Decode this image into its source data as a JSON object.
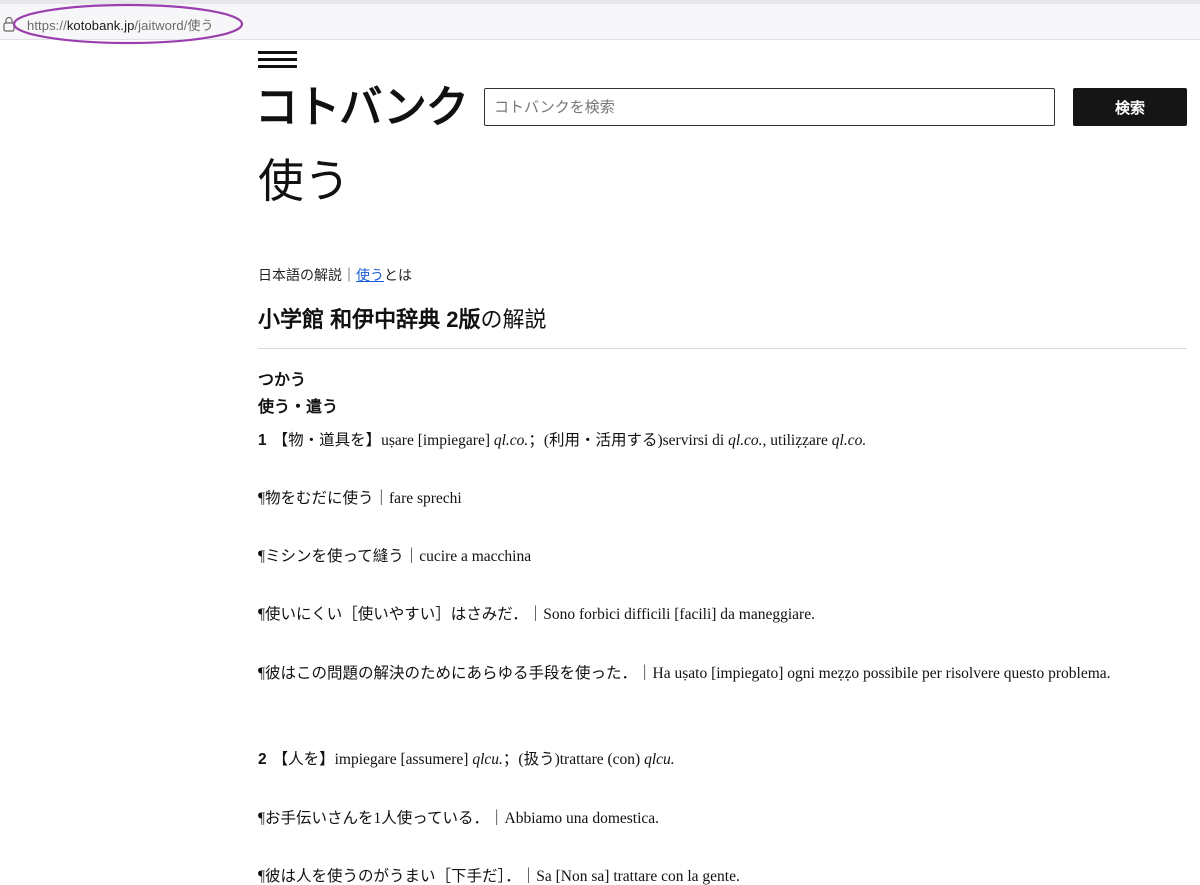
{
  "browser": {
    "url_prefix": "https://",
    "url_host": "kotobank.jp",
    "url_path": "/jaitword/使う"
  },
  "header": {
    "logo": "コトバンク",
    "search_placeholder": "コトバンクを検索",
    "search_button": "検索"
  },
  "page_title": "使う",
  "breadcrumb": {
    "prefix": "日本語の解説｜",
    "link": "使う",
    "suffix": "とは"
  },
  "dictionary": {
    "name": "小学館 和伊中辞典 2版",
    "suffix": "の解説"
  },
  "entry": {
    "reading": "つかう",
    "headword": "使う・遣う",
    "sense1": {
      "num": "1",
      "a": "【物・道具を】uṣare [impiegare] ",
      "b": "ql.co.",
      "c": "；(利用・活用する)servirsi di ",
      "d": "ql.co.",
      "e": ", utiliẓẓare ",
      "f": "ql.co."
    },
    "ex1": "¶物をむだに使う｜fare sprechi",
    "ex2": "¶ミシンを使って縫う｜cucire a macchina",
    "ex3": "¶使いにくい［使いやすい］はさみだ．｜Sono forbici difficili [facili] da maneggiare.",
    "ex4": "¶彼はこの問題の解決のためにあらゆる手段を使った．｜Ha uṣato [impiegato] ogni meẓẓo possibile per risolvere questo problema.",
    "sense2": {
      "num": "2",
      "a": "【人を】impiegare [assumere] ",
      "b": "qlcu.",
      "c": "；(扱う)trattare (con) ",
      "d": "qlcu."
    },
    "ex5": "¶お手伝いさんを1人使っている．｜Abbiamo una domestica.",
    "ex6": "¶彼は人を使うのがうまい［下手だ］．｜Sa [Non sa] trattare con la gente."
  },
  "colors": {
    "accent_link": "#1a5fd6",
    "button_bg": "#151515",
    "highlight_oval": "#9b3fb0"
  }
}
